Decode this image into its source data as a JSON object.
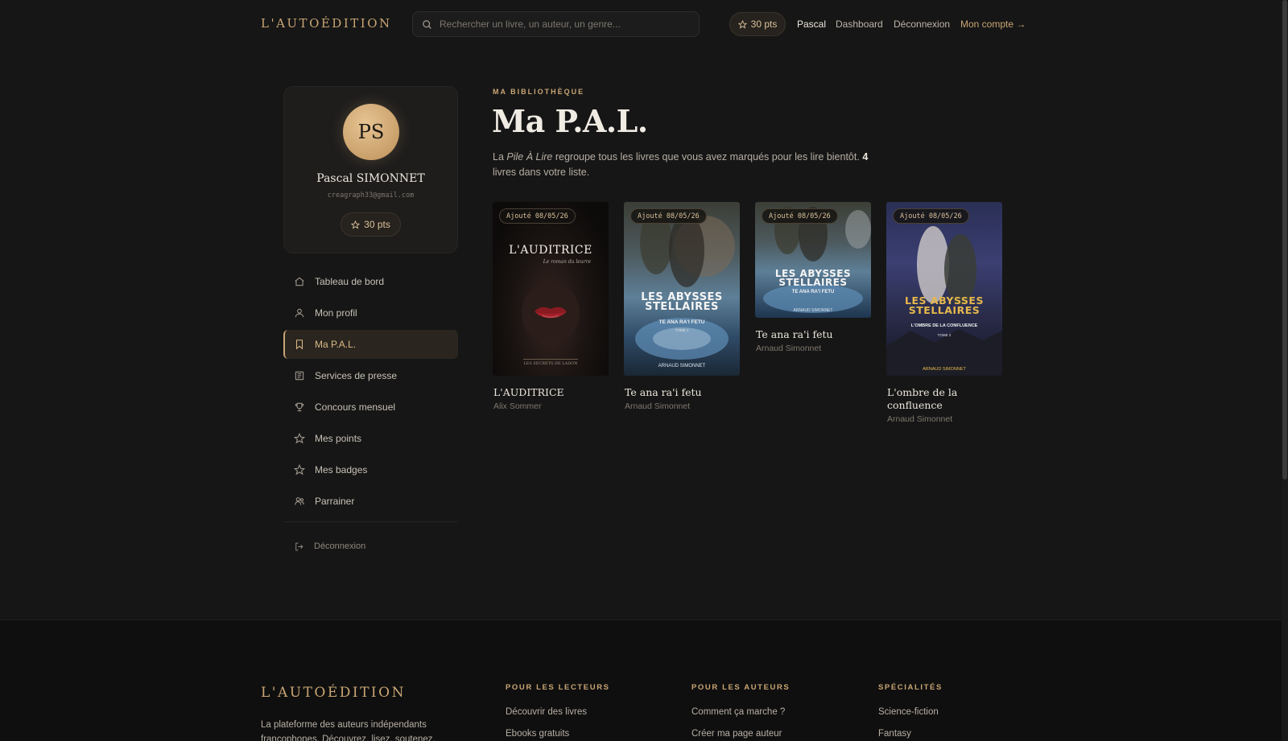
{
  "header": {
    "logo": "L'AUTOÉDITION",
    "search_placeholder": "Rechercher un livre, un auteur, un genre...",
    "points": "30 pts",
    "user": "Pascal",
    "dashboard": "Dashboard",
    "logout": "Déconnexion",
    "account": "Mon compte →"
  },
  "profile": {
    "initials": "PS",
    "name": "Pascal SIMONNET",
    "email": "creagraph33@gmail.com",
    "points": "30 pts"
  },
  "menu": {
    "items": [
      {
        "label": "Tableau de bord",
        "icon": "home-icon"
      },
      {
        "label": "Mon profil",
        "icon": "user-icon"
      },
      {
        "label": "Ma P.A.L.",
        "icon": "bookmark-icon",
        "active": true
      },
      {
        "label": "Services de presse",
        "icon": "newspaper-icon"
      },
      {
        "label": "Concours mensuel",
        "icon": "trophy-icon"
      },
      {
        "label": "Mes points",
        "icon": "star-icon"
      },
      {
        "label": "Mes badges",
        "icon": "star-icon"
      },
      {
        "label": "Parrainer",
        "icon": "users-icon"
      }
    ],
    "logout": "Déconnexion"
  },
  "main": {
    "eyebrow": "MA BIBLIOTHÈQUE",
    "title": "Ma P.A.L.",
    "intro_1": "La ",
    "intro_em": "Pile À Lire",
    "intro_2": " regroupe tous les livres que vous avez marqués pour les lire bientôt. ",
    "intro_count": "4",
    "intro_3": " livres dans votre liste."
  },
  "books": [
    {
      "added": "Ajouté 08/05/26",
      "title": "L'AUDITRICE",
      "author": "Alix Sommer",
      "cover_title": "L'AUDITRICE",
      "cover_sub": "Le roman du leurre",
      "cover_footer": "LES SECRETS DE LADON"
    },
    {
      "added": "Ajouté 08/05/26",
      "title": "Te ana ra'i fetu",
      "author": "Arnaud Simonnet",
      "cover_title": "LES ABYSSES STELLAIRES",
      "cover_sub": "TE ANA RA'I FETU",
      "cover_tome": "TOME 1",
      "cover_footer": "ARNAUD SIMONNET"
    },
    {
      "added": "Ajouté 08/05/26",
      "title": "Te ana ra'i fetu",
      "author": "Arnaud Simonnet",
      "cover_title": "LES ABYSSES STELLAIRES",
      "cover_sub": "TE ANA RA'I FETU",
      "cover_footer": "ARNAUD SIMONNET"
    },
    {
      "added": "Ajouté 08/05/26",
      "title": "L'ombre de la confluence",
      "author": "Arnaud Simonnet",
      "cover_title": "LES ABYSSES STELLAIRES",
      "cover_sub": "L'OMBRE DE LA CONFLUENCE",
      "cover_tome": "TOME 2",
      "cover_footer": "ARNAUD SIMONNET"
    }
  ],
  "footer": {
    "logo": "L'AUTOÉDITION",
    "about": "La plateforme des auteurs indépendants francophones. Découvrez, lisez, soutenez.",
    "readers": {
      "heading": "POUR LES LECTEURS",
      "links": [
        "Découvrir des livres",
        "Ebooks gratuits"
      ]
    },
    "authors": {
      "heading": "POUR LES AUTEURS",
      "links": [
        "Comment ça marche ?",
        "Créer ma page auteur"
      ]
    },
    "specialties": {
      "heading": "SPÉCIALITÉS",
      "links": [
        "Science-fiction",
        "Fantasy"
      ]
    }
  },
  "colors": {
    "accent": "#c9a574",
    "background": "#161616",
    "footer": "#0f0f0f"
  }
}
